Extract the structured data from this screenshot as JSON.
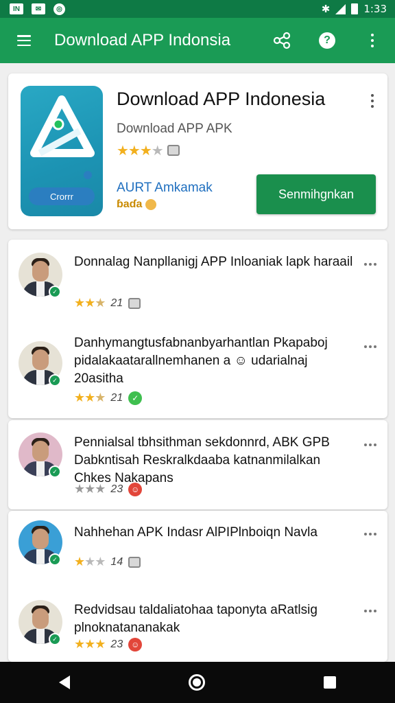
{
  "status_bar": {
    "icons_left": [
      "sim-icon",
      "mail-icon",
      "sync-icon"
    ],
    "time": "1:33"
  },
  "app_bar": {
    "title": "Download APP Indonsia",
    "actions": [
      "share-icon",
      "help-icon",
      "more-icon"
    ]
  },
  "app_card": {
    "name": "Download APP Indonesia",
    "subtitle": "Download APP APK",
    "rating": 3,
    "icon_button_label": "Crorrr",
    "developer": "AURT Amkamak",
    "badge": "ɓaɗa",
    "install_label": "Senmihgnkan"
  },
  "reviews": [
    {
      "text": "Donnalag Nanpllanigj APP Inloaniak lapk haraail",
      "rating": 2.5,
      "count": "21",
      "icon": "tag-icon"
    },
    {
      "text": "Danhymangtusfabnanbyarhantlan Pkapaboj pidalakaatarallnemhanen a ☺ udarialnaj 20asitha",
      "rating": 2.5,
      "count": "21",
      "icon": "chat-icon"
    },
    {
      "text": "Pennialsal tbhsithman sekdonnrd, ABK GPB Dabkntisah Reskralkdaaba katnanmilalkan Chkes Nakapans",
      "rating": 3,
      "count": "23",
      "icon": "emoji-icon",
      "gray": true
    },
    {
      "text": "Nahhehan APK Indasr AlPIPlnboiqn Navla",
      "rating": 1,
      "count": "14",
      "icon": "tag-icon"
    },
    {
      "text": "Redvidsau taldaliatohaa taponyta aRatlsig plnoknatananakak",
      "rating": 3,
      "count": "23",
      "icon": "emoji-icon"
    }
  ],
  "colors": {
    "primary": "#1a9b55",
    "status": "#0e7a45",
    "star": "#f2b01e"
  }
}
